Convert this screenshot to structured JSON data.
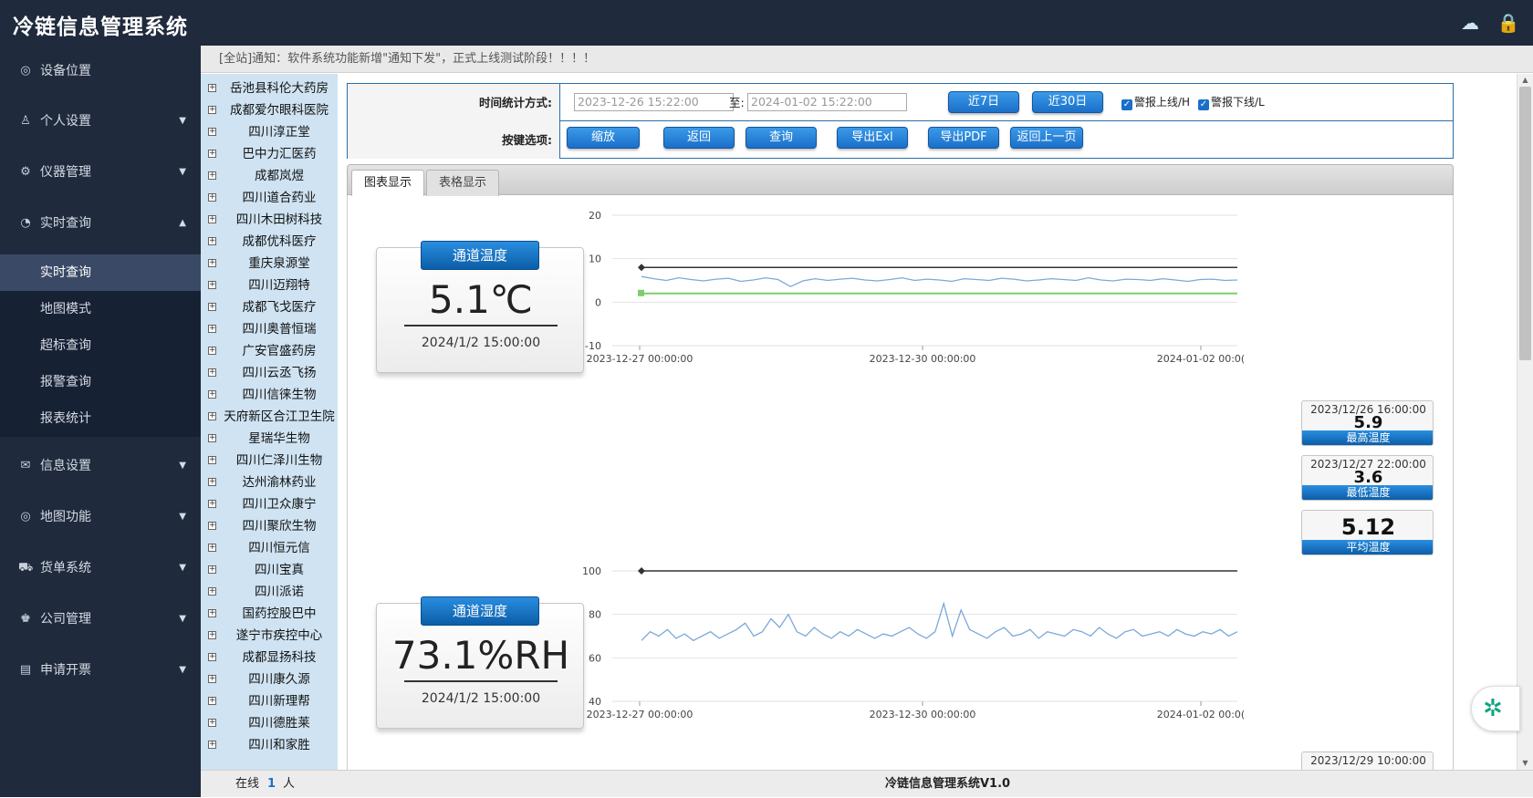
{
  "app": {
    "title": "冷链信息管理系统"
  },
  "top_icons": {
    "help": "cloud-help-icon",
    "user": "user-icon"
  },
  "sidebar": {
    "items": [
      {
        "label": "设备位置",
        "icon": "location-icon",
        "has_caret": false
      },
      {
        "label": "个人设置",
        "icon": "person-icon",
        "has_caret": true
      },
      {
        "label": "仪器管理",
        "icon": "gear-icon",
        "has_caret": true
      },
      {
        "label": "实时查询",
        "icon": "dashboard-icon",
        "has_caret": true,
        "expanded": true
      }
    ],
    "sub_items": [
      {
        "label": "实时查询",
        "active": true
      },
      {
        "label": "地图模式"
      },
      {
        "label": "超标查询"
      },
      {
        "label": "报警查询"
      },
      {
        "label": "报表统计"
      }
    ],
    "items_after": [
      {
        "label": "信息设置",
        "icon": "mail-icon"
      },
      {
        "label": "地图功能",
        "icon": "location-icon"
      },
      {
        "label": "货单系统",
        "icon": "cart-icon"
      },
      {
        "label": "公司管理",
        "icon": "people-icon"
      },
      {
        "label": "申请开票",
        "icon": "invoice-icon"
      }
    ]
  },
  "notice": {
    "text": "[全站]通知：软件系统功能新增\"通知下发\"，正式上线测试阶段！！！！"
  },
  "tree": {
    "items": [
      "岳池县科伦大药房",
      "成都爱尔眼科医院",
      "四川淳正堂",
      "巴中力汇医药",
      "成都岚煜",
      "四川道合药业",
      "四川木田树科技",
      "成都优科医疗",
      "重庆泉源堂",
      "四川迈翔特",
      "成都飞戈医疗",
      "四川奥普恒瑞",
      "广安官盛药房",
      "四川云丞飞扬",
      "四川信徕生物",
      "天府新区合江卫生院",
      "星瑞华生物",
      "四川仁泽川生物",
      "达州渝林药业",
      "四川卫众康宁",
      "四川聚欣生物",
      "四川恒元信",
      "四川宝真",
      "四川派诺",
      "国药控股巴中",
      "遂宁市疾控中心",
      "成都显扬科技",
      "四川康久源",
      "四川新理帮",
      "四川德胜莱",
      "四川和家胜"
    ]
  },
  "filter": {
    "time_label": "时间统计方式:",
    "start_placeholder": "2023-12-26 15:22:00",
    "to_label": "至:",
    "end_placeholder": "2024-01-02 15:22:00",
    "btn_7d": "近7日",
    "btn_30d": "近30日",
    "chk_upper": "警报上线/H",
    "chk_lower": "警报下线/L",
    "key_label": "按键选项:",
    "btn_zoom": "缩放",
    "btn_back": "返回",
    "btn_query": "查询",
    "btn_export_xls": "导出Exl",
    "btn_export_pdf": "导出PDF",
    "btn_prev": "返回上一页"
  },
  "tabs": {
    "chart": "图表显示",
    "table": "表格显示"
  },
  "temp_gauge": {
    "header": "通道温度",
    "value": "5.1℃",
    "time": "2024/1/2 15:00:00"
  },
  "hum_gauge": {
    "header": "通道湿度",
    "value": "73.1%RH",
    "time": "2024/1/2 15:00:00"
  },
  "temp_stats": {
    "max_time": "2023/12/26 16:00:00",
    "max_value": "5.9",
    "max_label": "最高温度",
    "min_time": "2023/12/27 22:00:00",
    "min_value": "3.6",
    "min_label": "最低温度",
    "avg_value": "5.12",
    "avg_label": "平均温度"
  },
  "hum_stats": {
    "max_time": "2023/12/29 10:00:00"
  },
  "footer": {
    "online_label": "在线",
    "online_count": "1",
    "online_unit": "人",
    "version": "冷链信息管理系统V1.0"
  },
  "colors": {
    "sidebar_bg": "#1f2a3d",
    "accent": "#1b6fc9",
    "line": "#7aa9da",
    "upper": "#333333",
    "lower": "#7ccf6a"
  },
  "chart_data": [
    {
      "type": "line",
      "ylim": [
        -10,
        20
      ],
      "yticks": [
        20,
        10,
        0,
        -10
      ],
      "xticks": [
        "2023-12-27 00:00:00",
        "2023-12-30 00:00:00",
        "2024-01-02 00:0("
      ],
      "series": [
        {
          "values": [
            5.9,
            5.4,
            5.0,
            5.6,
            5.2,
            4.9,
            5.3,
            5.5,
            4.8,
            5.1,
            5.6,
            5.2,
            3.6,
            4.9,
            5.4,
            5.0,
            5.3,
            5.5,
            5.1,
            4.9,
            5.2,
            5.6,
            5.0,
            5.3,
            5.1,
            4.8,
            5.4,
            5.2,
            5.0,
            5.5,
            5.3,
            4.9,
            5.1,
            5.4,
            5.2,
            5.0,
            5.6,
            5.1,
            4.9,
            5.3,
            5.2,
            5.0,
            5.4,
            5.1,
            4.8,
            5.2,
            5.3,
            5.0,
            5.1
          ]
        },
        {
          "value": 8
        },
        {
          "value": 2
        }
      ]
    },
    {
      "type": "line",
      "ylim": [
        40,
        100
      ],
      "yticks": [
        100,
        80,
        60,
        40
      ],
      "xticks": [
        "2023-12-27 00:00:00",
        "2023-12-30 00:00:00",
        "2024-01-02 00:0("
      ],
      "series": [
        {
          "values": [
            68,
            72,
            70,
            73,
            69,
            71,
            68,
            70,
            72,
            69,
            71,
            73,
            76,
            70,
            72,
            78,
            74,
            80,
            72,
            70,
            74,
            71,
            69,
            72,
            70,
            73,
            71,
            69,
            71,
            70,
            72,
            74,
            71,
            69,
            72,
            85,
            70,
            82,
            73,
            71,
            69,
            72,
            74,
            70,
            71,
            73,
            69,
            72,
            71,
            70,
            73,
            72,
            70,
            74,
            71,
            69,
            72,
            73,
            70,
            71,
            72,
            70,
            73,
            71,
            70,
            72,
            71,
            73,
            70,
            72
          ]
        },
        {
          "value": 100
        }
      ]
    }
  ]
}
